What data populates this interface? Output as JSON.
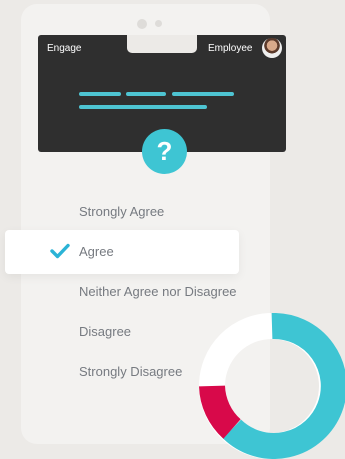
{
  "card": {
    "left_label": "Engage",
    "right_label": "Employee",
    "accent": "#4ec4d2",
    "background": "#2f2f2f"
  },
  "question_icon": "?",
  "options": [
    {
      "label": "Strongly Agree",
      "selected": false
    },
    {
      "label": "Agree",
      "selected": true
    },
    {
      "label": "Neither Agree nor Disagree",
      "selected": false
    },
    {
      "label": "Disagree",
      "selected": false
    },
    {
      "label": "Strongly Disagree",
      "selected": false
    }
  ],
  "colors": {
    "teal": "#3ec5d3",
    "pink": "#d8094a",
    "white": "#ffffff",
    "check": "#2bb3d6"
  }
}
